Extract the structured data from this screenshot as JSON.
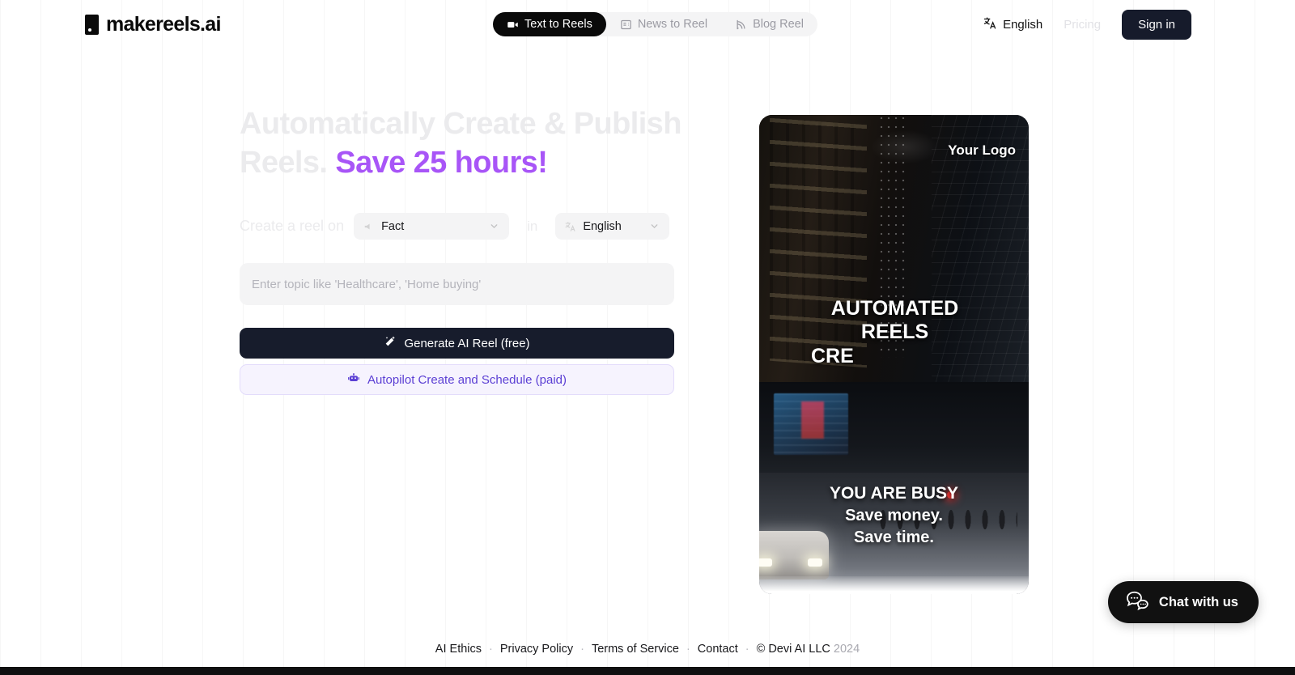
{
  "brand": {
    "name": "makereels.ai",
    "logo_icon": "square-dot-mark-icon"
  },
  "header": {
    "tabs": [
      {
        "label": "Text to Reels",
        "icon": "video-camera-icon",
        "active": true
      },
      {
        "label": "News to Reel",
        "icon": "newspaper-icon",
        "active": false
      },
      {
        "label": "Blog Reel",
        "icon": "blog-rss-icon",
        "active": false
      }
    ],
    "language": {
      "label": "English",
      "icon": "translate-icon"
    },
    "pricing_label": "Pricing",
    "signin_label": "Sign in"
  },
  "hero": {
    "headline_line1": "Automatically Create & Publish",
    "headline_line2_plain": "Reels.",
    "headline_line2_accent": "Save 25 hours!",
    "accent_color": "#a855f7",
    "form": {
      "prefix_label": "Create a reel on",
      "topic_select_value": "Fact",
      "topic_select_icon": "megaphone-icon",
      "in_label": "in",
      "language_select_value": "English",
      "language_select_icon": "translate-icon",
      "topic_placeholder": "Enter topic like 'Healthcare', 'Home buying'",
      "topic_value": "",
      "generate_label": "Generate AI Reel (free)",
      "generate_icon": "magic-wand-icon",
      "autopilot_label": "Autopilot Create and Schedule (paid)",
      "autopilot_icon": "robot-icon"
    }
  },
  "video_preview": {
    "watermark": "Your Logo",
    "caption_top_line1": "AUTOMATED",
    "caption_top_line2": "REELS",
    "caption_top_line3": "CRE",
    "caption_bottom_line1": "YOU ARE BUSY",
    "caption_bottom_line2": "Save money.",
    "caption_bottom_line3": "Save time."
  },
  "footer": {
    "links": [
      "AI Ethics",
      "Privacy Policy",
      "Terms of Service",
      "Contact"
    ],
    "separator": "·",
    "copyright": "© Devi AI LLC",
    "year": "2024"
  },
  "chat": {
    "label": "Chat with us",
    "icon": "chat-bubbles-icon"
  }
}
